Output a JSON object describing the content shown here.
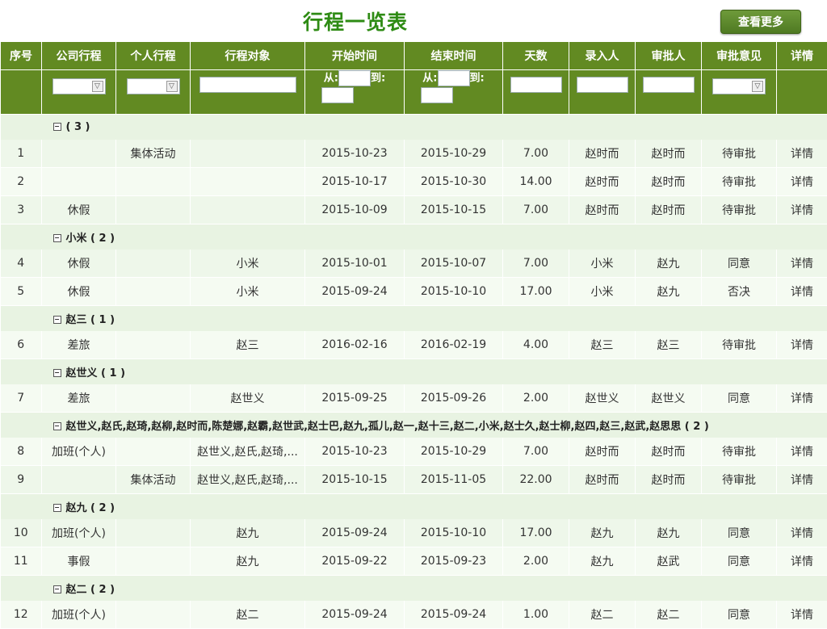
{
  "title": "行程一览表",
  "more_button": "查看更多",
  "columns": [
    "序号",
    "公司行程",
    "个人行程",
    "行程对象",
    "开始时间",
    "结束时间",
    "天数",
    "录入人",
    "审批人",
    "审批意见",
    "详情"
  ],
  "filters": {
    "from_label": "从:",
    "to_label": "到:"
  },
  "groups": [
    {
      "label": "( 3 )",
      "rows": [
        {
          "no": "1",
          "company": "",
          "personal": "集体活动",
          "target": "",
          "start": "2015-10-23",
          "end": "2015-10-29",
          "days": "7.00",
          "entered_by": "赵时而",
          "approver": "赵时而",
          "opinion": "待审批",
          "detail": "详情"
        },
        {
          "no": "2",
          "company": "",
          "personal": "",
          "target": "",
          "start": "2015-10-17",
          "end": "2015-10-30",
          "days": "14.00",
          "entered_by": "赵时而",
          "approver": "赵时而",
          "opinion": "待审批",
          "detail": "详情"
        },
        {
          "no": "3",
          "company": "休假",
          "personal": "",
          "target": "",
          "start": "2015-10-09",
          "end": "2015-10-15",
          "days": "7.00",
          "entered_by": "赵时而",
          "approver": "赵时而",
          "opinion": "待审批",
          "detail": "详情"
        }
      ]
    },
    {
      "label": "小米 ( 2 )",
      "rows": [
        {
          "no": "4",
          "company": "休假",
          "personal": "",
          "target": "小米",
          "start": "2015-10-01",
          "end": "2015-10-07",
          "days": "7.00",
          "entered_by": "小米",
          "approver": "赵九",
          "opinion": "同意",
          "detail": "详情"
        },
        {
          "no": "5",
          "company": "休假",
          "personal": "",
          "target": "小米",
          "start": "2015-09-24",
          "end": "2015-10-10",
          "days": "17.00",
          "entered_by": "小米",
          "approver": "赵九",
          "opinion": "否决",
          "detail": "详情"
        }
      ]
    },
    {
      "label": "赵三 ( 1 )",
      "rows": [
        {
          "no": "6",
          "company": "差旅",
          "personal": "",
          "target": "赵三",
          "start": "2016-02-16",
          "end": "2016-02-19",
          "days": "4.00",
          "entered_by": "赵三",
          "approver": "赵三",
          "opinion": "待审批",
          "detail": "详情"
        }
      ]
    },
    {
      "label": "赵世义 ( 1 )",
      "rows": [
        {
          "no": "7",
          "company": "差旅",
          "personal": "",
          "target": "赵世义",
          "start": "2015-09-25",
          "end": "2015-09-26",
          "days": "2.00",
          "entered_by": "赵世义",
          "approver": "赵世义",
          "opinion": "同意",
          "detail": "详情"
        }
      ]
    },
    {
      "label": "赵世义,赵氏,赵琦,赵柳,赵时而,陈楚娜,赵霸,赵世武,赵士巴,赵九,孤儿,赵一,赵十三,赵二,小米,赵士久,赵士柳,赵四,赵三,赵武,赵思思 ( 2 )",
      "rows": [
        {
          "no": "8",
          "company": "加班(个人)",
          "personal": "",
          "target": "赵世义,赵氏,赵琦,...",
          "start": "2015-10-23",
          "end": "2015-10-29",
          "days": "7.00",
          "entered_by": "赵时而",
          "approver": "赵时而",
          "opinion": "待审批",
          "detail": "详情"
        },
        {
          "no": "9",
          "company": "",
          "personal": "集体活动",
          "target": "赵世义,赵氏,赵琦,...",
          "start": "2015-10-15",
          "end": "2015-11-05",
          "days": "22.00",
          "entered_by": "赵时而",
          "approver": "赵时而",
          "opinion": "待审批",
          "detail": "详情"
        }
      ]
    },
    {
      "label": "赵九 ( 2 )",
      "rows": [
        {
          "no": "10",
          "company": "加班(个人)",
          "personal": "",
          "target": "赵九",
          "start": "2015-09-24",
          "end": "2015-10-10",
          "days": "17.00",
          "entered_by": "赵九",
          "approver": "赵九",
          "opinion": "同意",
          "detail": "详情"
        },
        {
          "no": "11",
          "company": "事假",
          "personal": "",
          "target": "赵九",
          "start": "2015-09-22",
          "end": "2015-09-23",
          "days": "2.00",
          "entered_by": "赵九",
          "approver": "赵武",
          "opinion": "同意",
          "detail": "详情"
        }
      ]
    },
    {
      "label": "赵二 ( 2 )",
      "rows": [
        {
          "no": "12",
          "company": "加班(个人)",
          "personal": "",
          "target": "赵二",
          "start": "2015-09-24",
          "end": "2015-09-24",
          "days": "1.00",
          "entered_by": "赵二",
          "approver": "赵二",
          "opinion": "同意",
          "detail": "详情"
        }
      ]
    }
  ]
}
